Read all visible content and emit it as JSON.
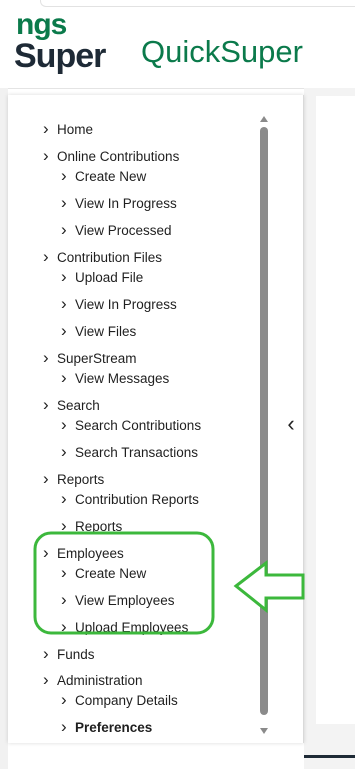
{
  "colors": {
    "brand_green": "#0b7a4b",
    "brand_dark": "#1e2a36",
    "annotation_green": "#3cb83c",
    "text": "#1f1f1f"
  },
  "header": {
    "logo_line1": "ngs",
    "logo_line2": "Super",
    "app_title": "QuickSuper"
  },
  "sidebar": {
    "collapse_icon": "chevron-left-icon",
    "items": [
      {
        "label": "Home",
        "level": 0
      },
      {
        "label": "Online Contributions",
        "level": 0
      },
      {
        "label": "Create New",
        "level": 1
      },
      {
        "label": "View In Progress",
        "level": 1
      },
      {
        "label": "View Processed",
        "level": 1
      },
      {
        "label": "Contribution Files",
        "level": 0
      },
      {
        "label": "Upload File",
        "level": 1
      },
      {
        "label": "View In Progress",
        "level": 1
      },
      {
        "label": "View Files",
        "level": 1
      },
      {
        "label": "SuperStream",
        "level": 0
      },
      {
        "label": "View Messages",
        "level": 1
      },
      {
        "label": "Search",
        "level": 0
      },
      {
        "label": "Search Contributions",
        "level": 1
      },
      {
        "label": "Search Transactions",
        "level": 1
      },
      {
        "label": "Reports",
        "level": 0
      },
      {
        "label": "Contribution Reports",
        "level": 1
      },
      {
        "label": "Reports",
        "level": 1
      },
      {
        "label": "Employees",
        "level": 0
      },
      {
        "label": "Create New",
        "level": 1
      },
      {
        "label": "View Employees",
        "level": 1
      },
      {
        "label": "Upload Employees",
        "level": 1
      },
      {
        "label": "Funds",
        "level": 0
      },
      {
        "label": "Administration",
        "level": 0
      },
      {
        "label": "Company Details",
        "level": 1
      },
      {
        "label": "Preferences",
        "level": 1,
        "active": true
      }
    ]
  },
  "annotation": {
    "highlight": "Employees",
    "arrow_direction": "left"
  }
}
